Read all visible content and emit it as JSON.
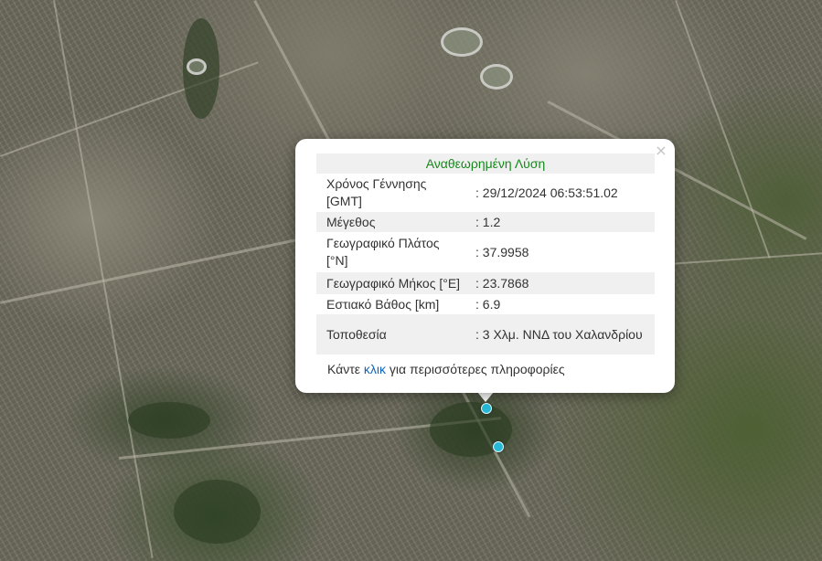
{
  "popup": {
    "title": "Αναθεωρημένη Λύση",
    "close_symbol": "×",
    "rows": [
      {
        "label": "Χρόνος Γέννησης [GMT]",
        "value": ": 29/12/2024 06:53:51.02"
      },
      {
        "label": "Μέγεθος",
        "value": ": 1.2"
      },
      {
        "label": "Γεωγραφικό Πλάτος [°N]",
        "value": ": 37.9958"
      },
      {
        "label": "Γεωγραφικό Μήκος [°E]",
        "value": ": 23.7868"
      },
      {
        "label": "Εστιακό Βάθος [km]",
        "value": ": 6.9"
      },
      {
        "label": "Τοποθεσία",
        "value": ": 3 Χλμ. ΝΝΔ του Χαλανδρίου"
      }
    ],
    "more_info": {
      "prefix": "Κάντε ",
      "link": "κλικ",
      "suffix": " για περισσότερες πληροφορίες"
    }
  },
  "colors": {
    "title_green": "#16891c",
    "link_blue": "#0b66c2",
    "marker_cyan": "#27b8d6"
  },
  "markers": [
    "earthquake-marker",
    "earthquake-marker"
  ]
}
